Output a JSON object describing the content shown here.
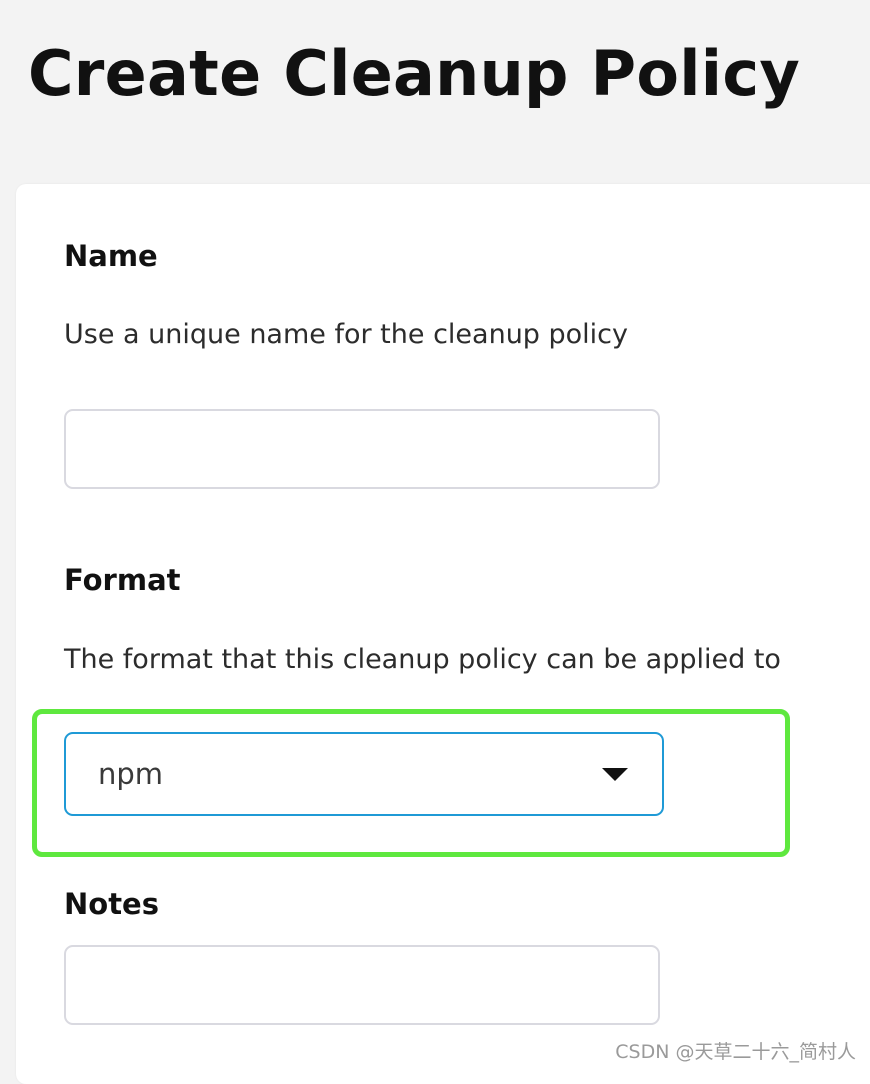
{
  "page": {
    "title": "Create Cleanup Policy"
  },
  "form": {
    "name": {
      "label": "Name",
      "help": "Use a unique name for the cleanup policy",
      "value": "",
      "placeholder": ""
    },
    "format": {
      "label": "Format",
      "help": "The format that this cleanup policy can be applied to",
      "selected": "npm",
      "caret_icon": "caret-down-icon"
    },
    "notes": {
      "label": "Notes",
      "value": "",
      "placeholder": ""
    }
  },
  "annotation": {
    "highlight_color": "#5ee83e"
  },
  "watermark": {
    "text": "CSDN @天草二十六_简村人"
  },
  "colors": {
    "background": "#f3f3f3",
    "card": "#ffffff",
    "select_border": "#1f9ad6",
    "input_border": "#d9d9e0"
  }
}
